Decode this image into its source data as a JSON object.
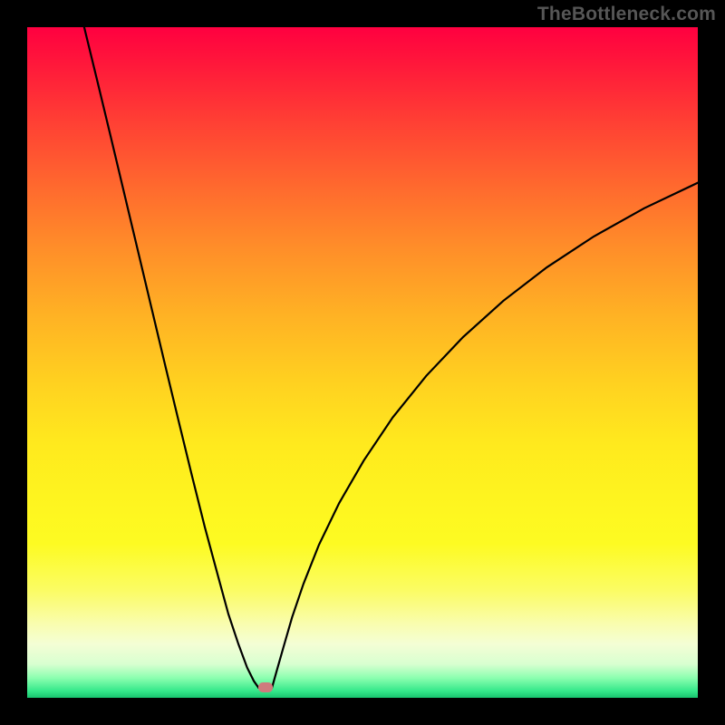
{
  "watermark": "TheBottleneck.com",
  "chart_data": {
    "type": "line",
    "title": "",
    "xlabel": "",
    "ylabel": "",
    "xlim": [
      0,
      740
    ],
    "ylim": [
      0,
      740
    ],
    "background": "rainbow-gradient red→green (vertical)",
    "marker": {
      "x_frac": 0.355,
      "y_frac": 0.985,
      "color": "#cf7b7d"
    },
    "series": [
      {
        "name": "bottleneck-curve",
        "description": "Two-branch curve descending from top-left and mid-right, meeting near bottom at x≈0.35; flat segment at the bottom around the minimum.",
        "left_branch_x": [
          0.085,
          0.105,
          0.125,
          0.145,
          0.165,
          0.185,
          0.205,
          0.225,
          0.245,
          0.265,
          0.285,
          0.3,
          0.315,
          0.328,
          0.338,
          0.345
        ],
        "left_branch_y": [
          0.0,
          0.082,
          0.165,
          0.249,
          0.333,
          0.417,
          0.501,
          0.584,
          0.666,
          0.746,
          0.82,
          0.875,
          0.92,
          0.955,
          0.975,
          0.985
        ],
        "flat_x": [
          0.345,
          0.365
        ],
        "flat_y": [
          0.985,
          0.985
        ],
        "right_branch_x": [
          0.365,
          0.372,
          0.382,
          0.395,
          0.412,
          0.435,
          0.465,
          0.502,
          0.545,
          0.595,
          0.65,
          0.71,
          0.775,
          0.845,
          0.92,
          1.0
        ],
        "right_branch_y": [
          0.985,
          0.96,
          0.925,
          0.88,
          0.83,
          0.772,
          0.71,
          0.646,
          0.582,
          0.52,
          0.462,
          0.408,
          0.358,
          0.312,
          0.27,
          0.232
        ]
      }
    ]
  }
}
